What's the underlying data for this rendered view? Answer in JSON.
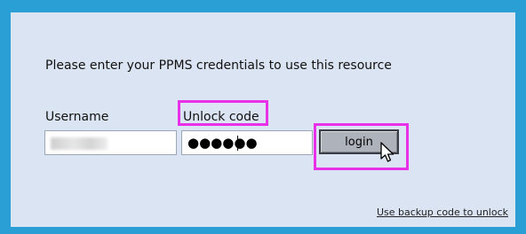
{
  "dialog": {
    "heading": "Please enter your PPMS credentials to use this resource",
    "username_label": "Username",
    "unlock_code_label": "Unlock code",
    "unlock_code_masked": "●●●●●●",
    "login_label": "login",
    "backup_link": "Use backup code to unlock"
  },
  "colors": {
    "frame_border": "#2a9fd6",
    "panel_background": "#dbe4f2",
    "highlight": "#e930e9",
    "button_face": "#aeb2bb"
  },
  "icons": {
    "cursor": "mouse-pointer-icon"
  }
}
